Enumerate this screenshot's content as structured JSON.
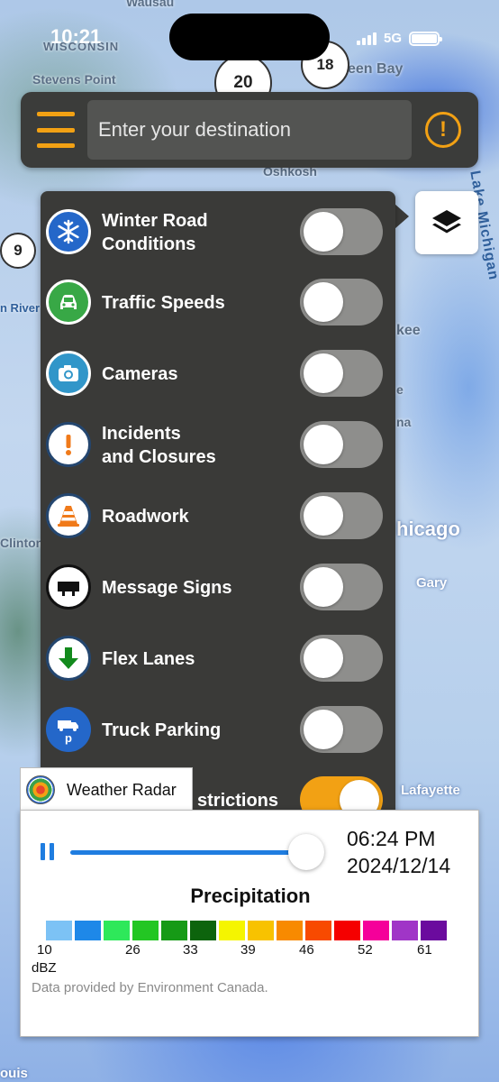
{
  "status_bar": {
    "time": "10:21",
    "network": "5G"
  },
  "map": {
    "labels": {
      "wausau": "Wausau",
      "wisconsin": "WISCONSIN",
      "stevens_point": "Stevens Point",
      "green_bay": "een Bay",
      "oshkosh": "Oshkosh",
      "lake_michigan": "Lake Michigan",
      "kee": "kee",
      "river": "n River",
      "e": "e",
      "na": "na",
      "chicago": "hicago",
      "clinton": "Clinton",
      "gary": "Gary",
      "lafayette": "Lafayette",
      "louis": "ouis"
    },
    "routes": {
      "r20": "20",
      "r18": "18",
      "r9": "9"
    }
  },
  "search": {
    "placeholder": "Enter your destination"
  },
  "alert_label": "!",
  "layers": [
    {
      "label": "Winter Road\nConditions",
      "icon": "snowflake-icon",
      "enabled": false
    },
    {
      "label": "Traffic Speeds",
      "icon": "car-icon",
      "enabled": false
    },
    {
      "label": "Cameras",
      "icon": "camera-icon",
      "enabled": false
    },
    {
      "label": "Incidents\nand Closures",
      "icon": "exclamation-icon",
      "enabled": false
    },
    {
      "label": "Roadwork",
      "icon": "traffic-cone-icon",
      "enabled": false
    },
    {
      "label": "Message Signs",
      "icon": "message-sign-icon",
      "enabled": false
    },
    {
      "label": "Flex Lanes",
      "icon": "down-arrow-icon",
      "enabled": false
    },
    {
      "label": "Truck Parking",
      "icon": "truck-parking-icon",
      "enabled": false
    },
    {
      "label": "strictions",
      "icon": "restrictions-icon",
      "enabled": true
    }
  ],
  "radar": {
    "tab_label": "Weather Radar",
    "time": "06:24 PM",
    "date": "2024/12/14",
    "progress": 0.95,
    "title": "Precipitation",
    "scale_colors": [
      "#7cc2f5",
      "#1e88e8",
      "#2ee85a",
      "#23c623",
      "#169a16",
      "#0d640d",
      "#f5f500",
      "#f8c200",
      "#f88a00",
      "#f84a00",
      "#f50000",
      "#f5009a",
      "#a035c7",
      "#6b0b9e"
    ],
    "scale_labels": [
      "10",
      "26",
      "33",
      "39",
      "46",
      "52",
      "61"
    ],
    "unit": "dBZ",
    "credit": "Data provided by Environment Canada."
  }
}
